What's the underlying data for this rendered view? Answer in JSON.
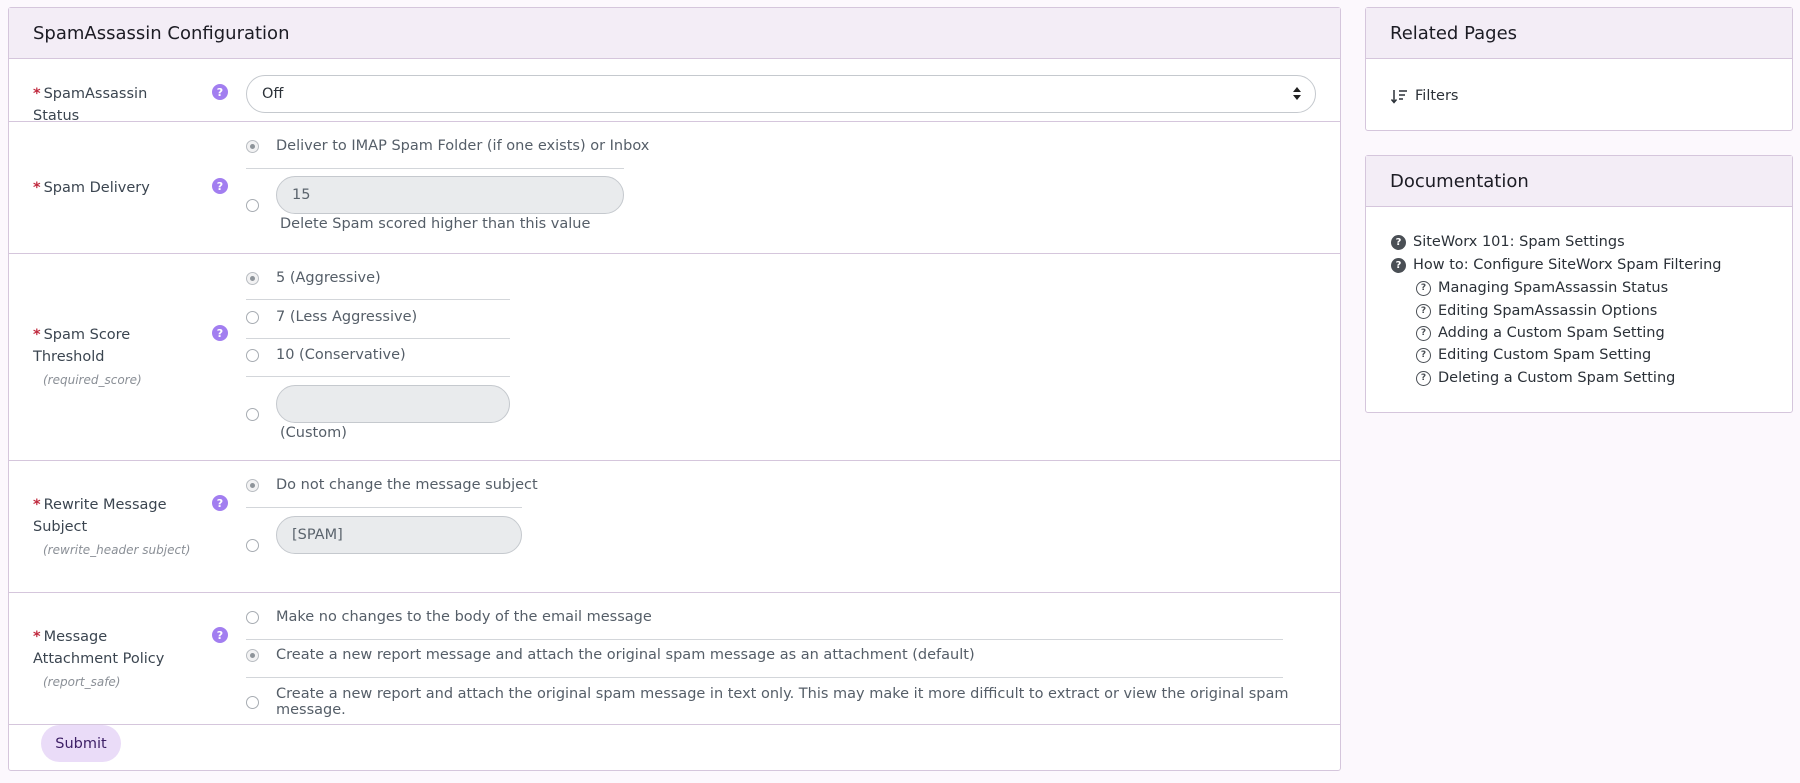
{
  "main": {
    "title": "SpamAssassin Configuration",
    "status": {
      "label": "SpamAssassin Status",
      "value": "Off"
    },
    "spam_delivery": {
      "label": "Spam Delivery",
      "option_deliver": "Deliver to IMAP Spam Folder (if one exists) or Inbox",
      "delete_value": "15",
      "delete_caption": "Delete Spam scored higher than this value"
    },
    "spam_score": {
      "label": "Spam Score Threshold",
      "hint": "(required_score)",
      "options": [
        "5 (Aggressive)",
        "7 (Less Aggressive)",
        "10 (Conservative)"
      ],
      "custom_caption": "(Custom)"
    },
    "rewrite_subject": {
      "label": "Rewrite Message Subject",
      "hint": "(rewrite_header subject)",
      "option_no_change": "Do not change the message subject",
      "subject_value": "[SPAM]"
    },
    "attachment_policy": {
      "label": "Message Attachment Policy",
      "hint": "(report_safe)",
      "options": [
        "Make no changes to the body of the email message",
        "Create a new report message and attach the original spam message as an attachment (default)",
        "Create a new report and attach the original spam message in text only. This may make it more difficult to extract or view the original spam message."
      ]
    },
    "submit_label": "Submit"
  },
  "related": {
    "title": "Related Pages",
    "filters_label": "Filters"
  },
  "documentation": {
    "title": "Documentation",
    "links": [
      "SiteWorx 101: Spam Settings",
      "How to: Configure SiteWorx Spam Filtering"
    ],
    "sub_links": [
      "Managing SpamAssassin Status",
      "Editing SpamAssassin Options",
      "Adding a Custom Spam Setting",
      "Editing Custom Spam Setting",
      "Deleting a Custom Spam Setting"
    ]
  },
  "icons": {
    "help": "help-icon",
    "sort": "sort-icon",
    "question_solid": "question-circle-icon",
    "question_outline": "question-circle-outline-icon"
  },
  "colors": {
    "accent": "#a27ef0",
    "required": "#c0283d",
    "header_bg": "#f3edf6",
    "submit_bg": "#eadcf8"
  }
}
